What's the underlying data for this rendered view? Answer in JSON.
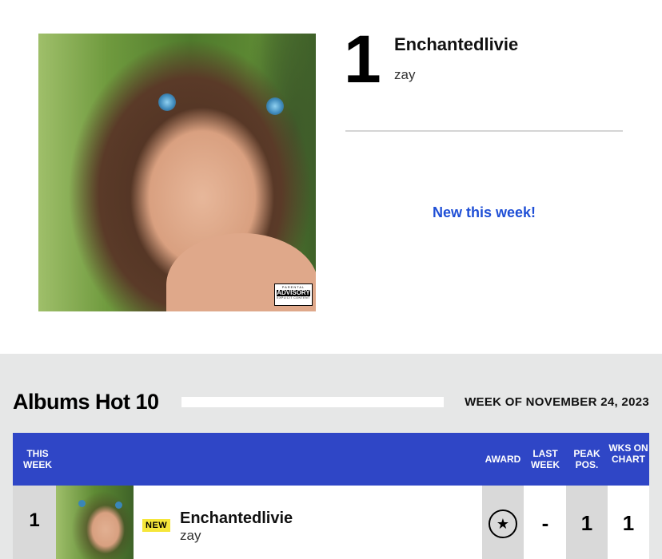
{
  "hero": {
    "rank": "1",
    "title": "Enchantedlivie",
    "artist": "zay",
    "new_label": "New this week!",
    "advisory": {
      "line1": "PARENTAL",
      "line2": "ADVISORY",
      "line3": "EXPLICIT CONTENT"
    }
  },
  "chart": {
    "title": "Albums Hot 10",
    "week": "WEEK OF NOVEMBER 24, 2023",
    "headers": {
      "this_week": "THIS WEEK",
      "award": "AWARD",
      "last_week": "LAST WEEK",
      "peak": "PEAK POS.",
      "wks": "WKS ON CHART"
    },
    "rows": [
      {
        "rank": "1",
        "badge": "NEW",
        "title": "Enchantedlivie",
        "artist": "zay",
        "award_icon": "star-icon",
        "last_week": "-",
        "peak": "1",
        "wks": "1"
      }
    ]
  },
  "colors": {
    "accent_blue": "#2f46c6",
    "link_blue": "#1f4fd6",
    "new_badge": "#f5e63a",
    "section_bg": "#e6e7e7"
  }
}
